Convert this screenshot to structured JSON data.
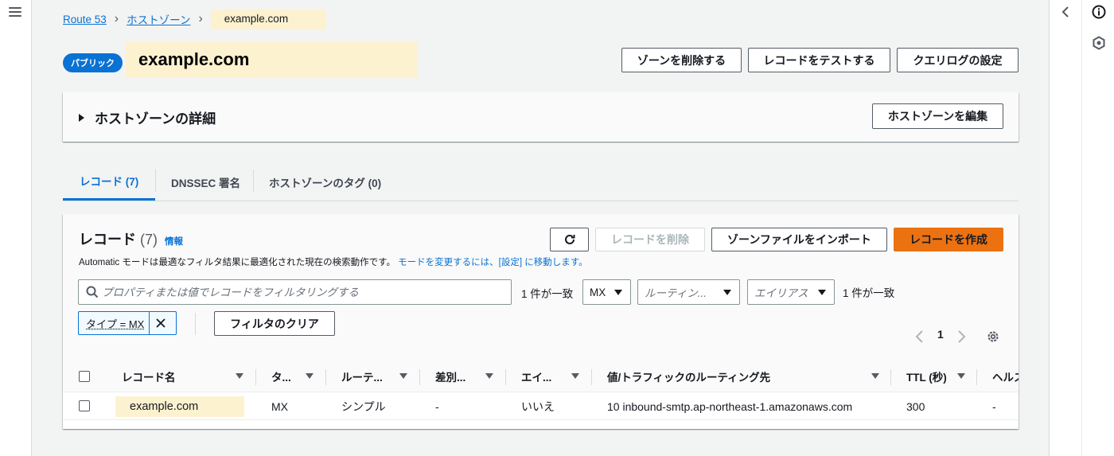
{
  "nav": {
    "menu_icon": "hamburger-menu-icon"
  },
  "breadcrumb": {
    "items": [
      "Route 53",
      "ホストゾーン"
    ],
    "current": "example.com"
  },
  "header": {
    "badge": "パブリック",
    "title": "example.com",
    "buttons": {
      "delete_zone": "ゾーンを削除する",
      "test_record": "レコードをテストする",
      "query_log": "クエリログの設定"
    }
  },
  "details": {
    "title": "ホストゾーンの詳細",
    "edit_button": "ホストゾーンを編集"
  },
  "tabs": [
    {
      "label": "レコード (7)",
      "active": true
    },
    {
      "label": "DNSSEC 署名",
      "active": false
    },
    {
      "label": "ホストゾーンのタグ (0)",
      "active": false
    }
  ],
  "records": {
    "title": "レコード",
    "count": "(7)",
    "info": "情報",
    "description": "Automatic モードは最適なフィルタ結果に最適化された現在の検索動作です。",
    "description_link": "モードを変更するには、[設定] に移動します。",
    "buttons": {
      "delete": "レコードを削除",
      "import": "ゾーンファイルをインポート",
      "create": "レコードを作成"
    },
    "search_placeholder": "プロパティまたは値でレコードをフィルタリングする",
    "match_text_1": "1 件が一致",
    "type_select": "MX",
    "routing_select": "ルーティン...",
    "alias_select": "エイリアス",
    "match_text_2": "1 件が一致",
    "token": "タイプ = MX",
    "clear_filter": "フィルタのクリア",
    "page": "1",
    "columns": [
      "レコード名",
      "タ...",
      "ルーテ...",
      "差別...",
      "エイ...",
      "値/トラフィックのルーティング先",
      "TTL (秒)",
      "ヘルス"
    ],
    "rows": [
      {
        "name": "example.com",
        "type": "MX",
        "routing": "シンプル",
        "differentiator": "-",
        "alias": "いいえ",
        "value": "10 inbound-smtp.ap-northeast-1.amazonaws.com",
        "ttl": "300",
        "health": "-"
      }
    ]
  },
  "colors": {
    "link": "#0972d3",
    "primary": "#ec7211",
    "highlight": "#fdf2d0"
  }
}
